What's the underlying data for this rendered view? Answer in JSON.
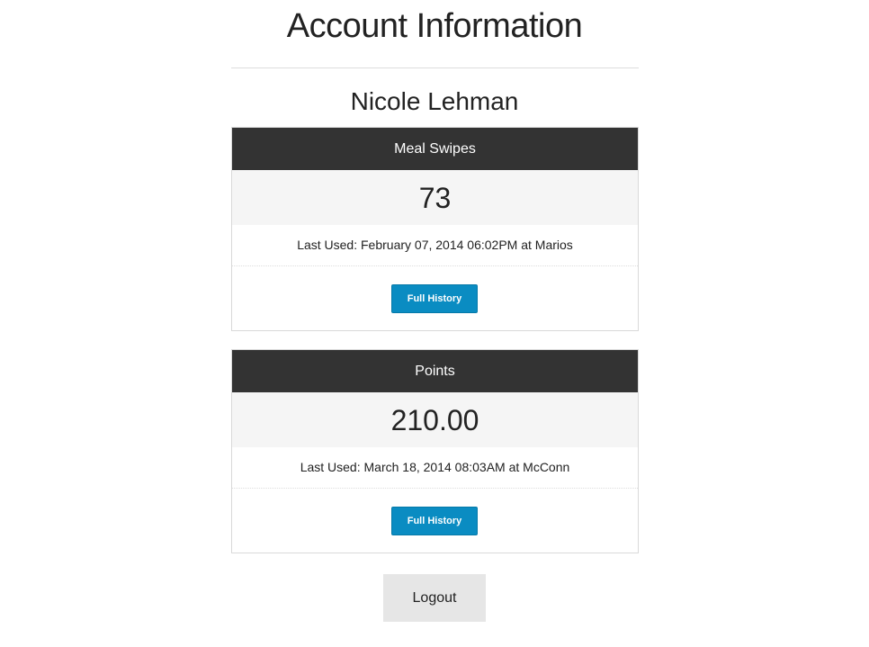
{
  "page": {
    "title": "Account Information",
    "user_name": "Nicole Lehman"
  },
  "meal_swipes": {
    "header": "Meal Swipes",
    "value": "73",
    "last_used": "Last Used: February 07, 2014 06:02PM at Marios",
    "history_label": "Full History"
  },
  "points": {
    "header": "Points",
    "value": "210.00",
    "last_used": "Last Used: March 18, 2014 08:03AM at McConn",
    "history_label": "Full History"
  },
  "actions": {
    "logout_label": "Logout"
  },
  "colors": {
    "header_bg": "#333333",
    "button_blue": "#0a8cc2",
    "value_bg": "#f5f5f5",
    "logout_bg": "#e6e6e6"
  }
}
